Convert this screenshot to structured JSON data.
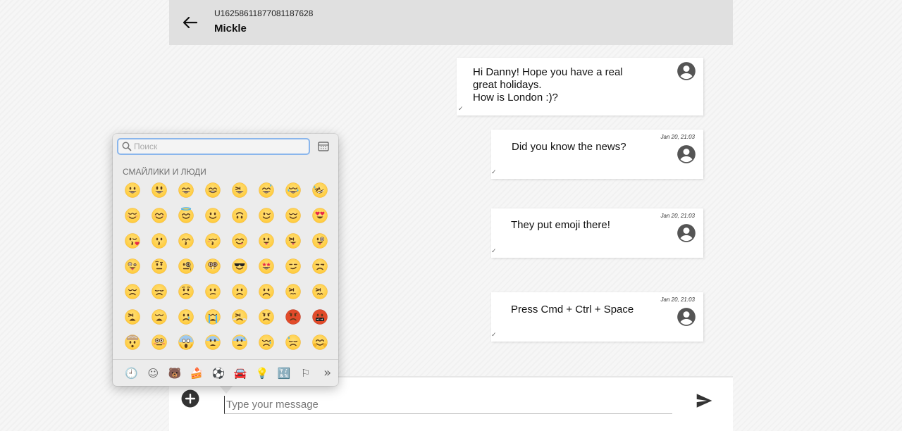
{
  "header": {
    "conversation_id": "U16258611877081187628",
    "name": "Mickle"
  },
  "messages": [
    {
      "text": "Hi Danny! Hope you have a real\ngreat holidays.\nHow is London :)?",
      "time": "",
      "check": "✓"
    },
    {
      "text": "Did you know the news?",
      "time": "Jan 20, 21:03",
      "check": "✓"
    },
    {
      "text": "They put emoji there!",
      "time": "Jan 20, 21:03",
      "check": "✓"
    },
    {
      "text": "Press Cmd + Ctrl + Space",
      "time": "Jan 20, 21:03",
      "check": "✓"
    }
  ],
  "composer": {
    "placeholder": "Type your message"
  },
  "emoji_picker": {
    "search_placeholder": "Поиск",
    "section_title": "СМАЙЛИКИ И ЛЮДИ",
    "emoji_rows": [
      [
        "grinning-face",
        "grinning-face-big-eyes",
        "grinning-face-smiling-eyes",
        "beaming-face",
        "grinning-squinting-face",
        "grinning-face-sweat",
        "tears-of-joy",
        "rolling-on-floor-laughing"
      ],
      [
        "smiling-face",
        "smiling-face-smiling-eyes",
        "smiling-face-halo",
        "slightly-smiling-face",
        "upside-down-face",
        "winking-face",
        "relieved-face",
        "heart-eyes"
      ],
      [
        "face-blowing-kiss",
        "kissing-face",
        "kissing-face-smiling-eyes",
        "kissing-face-closed-eyes",
        "face-savoring-food",
        "face-with-tongue",
        "squinting-face-tongue",
        "winking-face-tongue"
      ],
      [
        "zany-face",
        "face-raised-eyebrow",
        "face-with-monocle",
        "nerd-face",
        "smiling-face-sunglasses",
        "star-struck",
        "smirking-face",
        "unamused-face"
      ],
      [
        "disappointed-face",
        "pensive-face",
        "worried-face",
        "confused-face",
        "slightly-frowning-face",
        "frowning-face",
        "persevering-face",
        "confounded-face"
      ],
      [
        "tired-face",
        "weary-face",
        "crying-face",
        "loudly-crying-face",
        "face-steam-nose",
        "angry-face",
        "pouting-face",
        "face-with-symbols"
      ],
      [
        "exploding-head",
        "flushed-face",
        "screaming-in-fear",
        "fearful-face",
        "anxious-face-sweat",
        "sad-relieved-face",
        "downcast-sweat",
        "hugging-face"
      ]
    ],
    "categories": [
      {
        "name": "frequently-used",
        "glyph": "🕘"
      },
      {
        "name": "smileys-people",
        "glyph": "☺"
      },
      {
        "name": "animals-nature",
        "glyph": "🐻"
      },
      {
        "name": "food-drink",
        "glyph": "🍰"
      },
      {
        "name": "activity",
        "glyph": "⚽"
      },
      {
        "name": "travel-places",
        "glyph": "🚘"
      },
      {
        "name": "objects",
        "glyph": "💡"
      },
      {
        "name": "symbols",
        "glyph": "🔣"
      },
      {
        "name": "flags",
        "glyph": "⚐"
      },
      {
        "name": "more",
        "glyph": "»"
      }
    ],
    "colors": {
      "face": "#ffca3a",
      "face_edge": "#f0a818",
      "feature": "#5b3a1a",
      "heart": "#e8264a",
      "tongue": "#e8566a",
      "tear": "#4fb6ef",
      "red_face": "#e24b2a"
    }
  }
}
